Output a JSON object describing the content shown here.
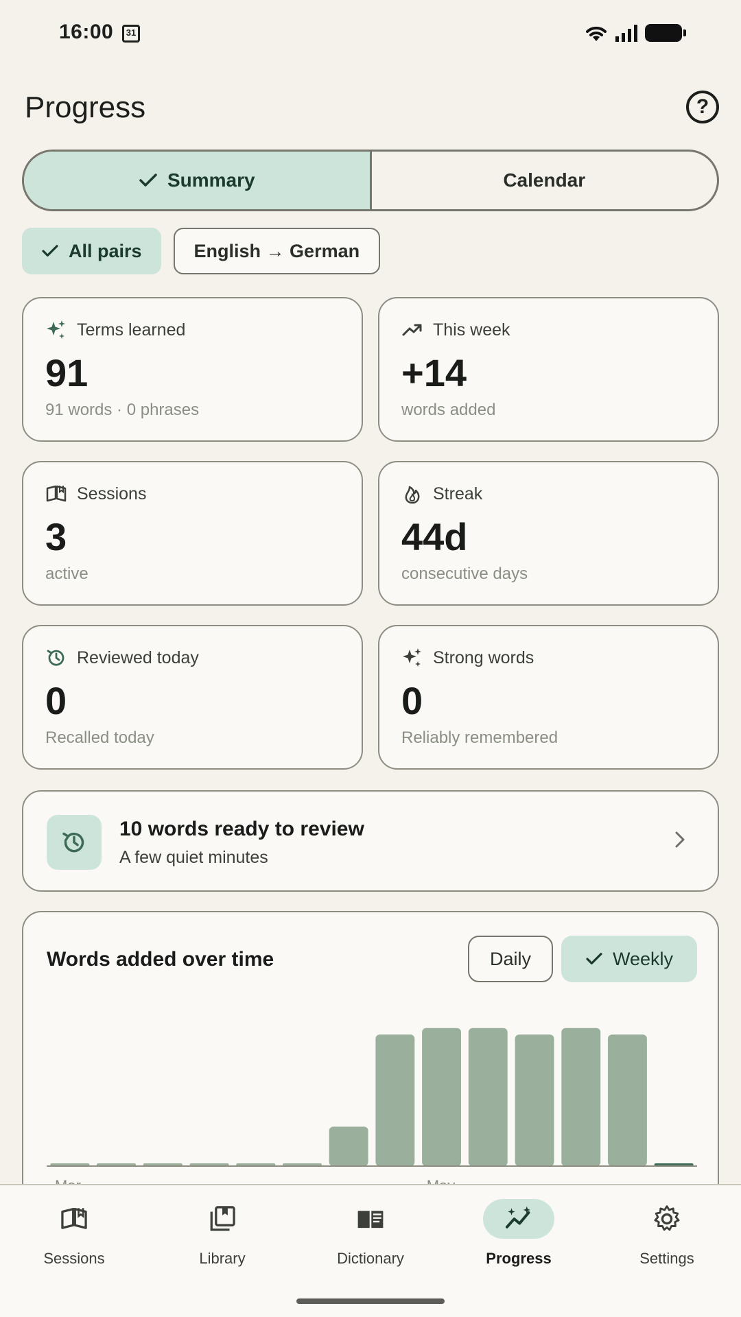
{
  "status": {
    "time": "16:00",
    "calendar_day": "31"
  },
  "header": {
    "title": "Progress"
  },
  "segments": {
    "summary": "Summary",
    "calendar": "Calendar"
  },
  "filters": {
    "all_pairs": "All pairs",
    "pair": "English → German"
  },
  "stats": [
    {
      "title": "Terms learned",
      "value": "91",
      "sub": "91 words · 0 phrases",
      "icon": "sparkle-icon"
    },
    {
      "title": "This week",
      "value": "+14",
      "sub": "words added",
      "icon": "trending-up-icon"
    },
    {
      "title": "Sessions",
      "value": "3",
      "sub": "active",
      "icon": "book-open-icon"
    },
    {
      "title": "Streak",
      "value": "44d",
      "sub": "consecutive days",
      "icon": "flame-icon"
    },
    {
      "title": "Reviewed today",
      "value": "0",
      "sub": "Recalled today",
      "icon": "history-icon"
    },
    {
      "title": "Strong words",
      "value": "0",
      "sub": "Reliably remembered",
      "icon": "sparkle-icon"
    }
  ],
  "review": {
    "title": "10 words ready to review",
    "subtitle": "A few quiet minutes"
  },
  "chart": {
    "title": "Words added over time",
    "daily_label": "Daily",
    "weekly_label": "Weekly",
    "accent": "#9bb09c"
  },
  "chart_data": {
    "type": "bar",
    "categories": [
      "w1",
      "w2",
      "w3",
      "w4",
      "w5",
      "w6",
      "w7",
      "w8",
      "w9",
      "w10",
      "w11",
      "w12",
      "w13",
      "w14"
    ],
    "values": [
      0,
      0,
      0,
      0,
      0,
      0,
      3,
      10,
      10.5,
      10.5,
      10,
      10.5,
      10,
      0
    ],
    "ylim": [
      0,
      12
    ],
    "xtick_labels": [
      "Mar",
      "May"
    ]
  },
  "nav": [
    {
      "label": "Sessions",
      "icon": "book-open-icon",
      "active": false
    },
    {
      "label": "Library",
      "icon": "library-icon",
      "active": false
    },
    {
      "label": "Dictionary",
      "icon": "dictionary-icon",
      "active": false
    },
    {
      "label": "Progress",
      "icon": "progress-icon",
      "active": true
    },
    {
      "label": "Settings",
      "icon": "gear-icon",
      "active": false
    }
  ],
  "colors": {
    "background": "#f5f1eb",
    "accent_container": "#cde4da",
    "bar": "#9bb09c",
    "bar_current": "#3e6b55"
  }
}
